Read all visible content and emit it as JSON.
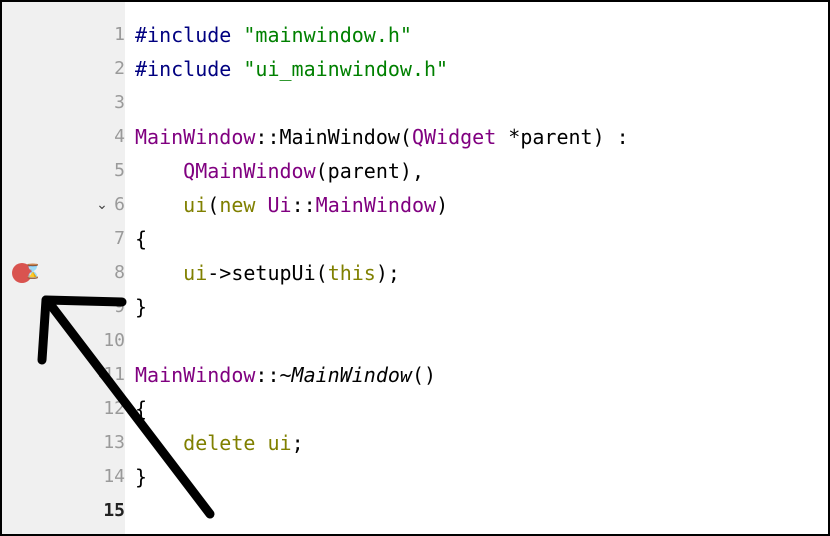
{
  "lines": [
    {
      "num": "1",
      "fold": "",
      "segments": [
        {
          "t": "#include ",
          "c": "pp"
        },
        {
          "t": "\"mainwindow.h\"",
          "c": "str"
        }
      ]
    },
    {
      "num": "2",
      "fold": "",
      "segments": [
        {
          "t": "#include ",
          "c": "pp"
        },
        {
          "t": "\"ui_mainwindow.h\"",
          "c": "str"
        }
      ]
    },
    {
      "num": "3",
      "fold": "",
      "segments": []
    },
    {
      "num": "4",
      "fold": "",
      "segments": [
        {
          "t": "MainWindow",
          "c": "ty"
        },
        {
          "t": "::MainWindow(",
          "c": ""
        },
        {
          "t": "QWidget",
          "c": "ty"
        },
        {
          "t": " *parent) :",
          "c": ""
        }
      ]
    },
    {
      "num": "5",
      "fold": "",
      "segments": [
        {
          "t": "    ",
          "c": ""
        },
        {
          "t": "QMainWindow",
          "c": "ty"
        },
        {
          "t": "(parent),",
          "c": ""
        }
      ]
    },
    {
      "num": "6",
      "fold": "⌄",
      "segments": [
        {
          "t": "    ",
          "c": ""
        },
        {
          "t": "ui",
          "c": "kw"
        },
        {
          "t": "(",
          "c": ""
        },
        {
          "t": "new",
          "c": "kw"
        },
        {
          "t": " ",
          "c": ""
        },
        {
          "t": "Ui",
          "c": "ty"
        },
        {
          "t": "::",
          "c": ""
        },
        {
          "t": "MainWindow",
          "c": "ty"
        },
        {
          "t": ")",
          "c": ""
        }
      ]
    },
    {
      "num": "7",
      "fold": "",
      "segments": [
        {
          "t": "{",
          "c": ""
        }
      ]
    },
    {
      "num": "8",
      "fold": "",
      "segments": [
        {
          "t": "    ",
          "c": ""
        },
        {
          "t": "ui",
          "c": "kw"
        },
        {
          "t": "->setupUi(",
          "c": ""
        },
        {
          "t": "this",
          "c": "kw"
        },
        {
          "t": ");",
          "c": ""
        }
      ]
    },
    {
      "num": "9",
      "fold": "",
      "segments": [
        {
          "t": "}",
          "c": ""
        }
      ]
    },
    {
      "num": "10",
      "fold": "",
      "segments": []
    },
    {
      "num": "11",
      "fold": "⌄",
      "segments": [
        {
          "t": "MainWindow",
          "c": "ty"
        },
        {
          "t": "::~",
          "c": ""
        },
        {
          "t": "MainWindow",
          "c": "it"
        },
        {
          "t": "()",
          "c": ""
        }
      ]
    },
    {
      "num": "12",
      "fold": "",
      "segments": [
        {
          "t": "{",
          "c": ""
        }
      ]
    },
    {
      "num": "13",
      "fold": "",
      "segments": [
        {
          "t": "    ",
          "c": ""
        },
        {
          "t": "delete",
          "c": "kw"
        },
        {
          "t": " ",
          "c": ""
        },
        {
          "t": "ui",
          "c": "kw"
        },
        {
          "t": ";",
          "c": ""
        }
      ]
    },
    {
      "num": "14",
      "fold": "",
      "segments": [
        {
          "t": "}",
          "c": ""
        }
      ]
    },
    {
      "num": "15",
      "fold": "",
      "segments": [],
      "current": true
    }
  ],
  "breakpoint": {
    "line": "8",
    "color": "#d9534f",
    "icon": "hourglass-icon",
    "glyph": "⌛"
  },
  "annotation": {
    "icon": "arrow-icon",
    "color": "#000000"
  }
}
